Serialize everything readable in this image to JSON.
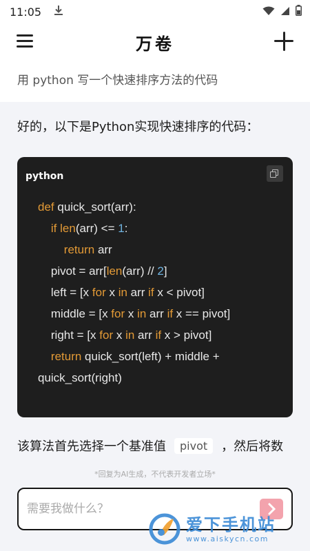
{
  "status_bar": {
    "time": "11:05",
    "icons": [
      "download-icon",
      "wifi-icon",
      "signal-icon",
      "battery-icon"
    ]
  },
  "header": {
    "title": "万卷",
    "icons": [
      "menu-icon",
      "plus-icon"
    ]
  },
  "conversation": {
    "user_message": "用 python 写一个快速排序方法的代码",
    "ai_intro": "好的，以下是Python实现快速排序的代码：",
    "code_block": {
      "language": "python",
      "copy_icon": "copy-icon",
      "lines": [
        "def quick_sort(arr):",
        "    if len(arr) <= 1:",
        "        return arr",
        "    pivot = arr[len(arr) // 2]",
        "    left = [x for x in arr if x < pivot]",
        "    middle = [x for x in arr if x == pivot]",
        "    right = [x for x in arr if x > pivot]",
        "    return quick_sort(left) + middle +",
        "quick_sort(right)"
      ]
    },
    "ai_continue_prefix": "该算法首先选择一个基准值",
    "ai_continue_code": "pivot",
    "ai_continue_suffix": "，然后将数"
  },
  "disclaimer": "*回复为AI生成，不代表开发者立场*",
  "composer": {
    "placeholder": "需要我做什么？",
    "send_icon": "chevron-right-icon"
  },
  "watermark": {
    "text": "爱下手机站",
    "url": "www.aiskycn.com"
  },
  "colors": {
    "accent_send": "#f3a3ad",
    "code_bg": "#1e1e1e",
    "keyword": "#e39a36",
    "number": "#6fb3e0",
    "watermark": "#3d8bd6"
  }
}
